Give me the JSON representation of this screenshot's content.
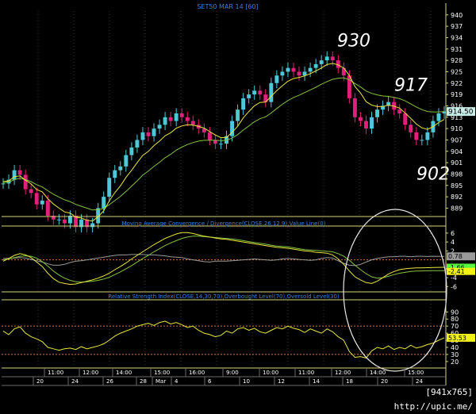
{
  "window": {
    "footer": "[941x765] http://upic.me/"
  },
  "colors": {
    "background": "#000000",
    "frame": "#d4d47a",
    "grid": "#3a3a3a",
    "title": "#3e7fd9",
    "price_up": "#4ec7d6",
    "price_down": "#e0207a",
    "ma_short": "#e8e83a",
    "ma_long": "#86c23d",
    "ref_line": "#d8763a",
    "macd_hist": "#9a9a9a",
    "annotation": "#ffffff",
    "last_price_box": "#c8ece6",
    "macd_box1": "#9a9a9a",
    "macd_box2": "#56ff3c",
    "macd_box3": "#f2f215",
    "rsi_box": "#f2f215"
  },
  "chart_data": [
    {
      "type": "line",
      "title": "SET50 MAR 14   [60]",
      "ylim": [
        887,
        941
      ],
      "yticks": [
        889,
        892,
        895,
        898,
        901,
        904,
        907,
        910,
        913,
        916,
        919,
        922,
        925,
        928,
        931,
        934,
        937,
        940
      ],
      "last_price": "914.50",
      "series": [
        {
          "name": "Close",
          "values": [
            895.5,
            896.5,
            899,
            897.8,
            894,
            893,
            890,
            891,
            887,
            886,
            886,
            885,
            887,
            884,
            886,
            884,
            885,
            889,
            892,
            897,
            899,
            900,
            903,
            905,
            907,
            909,
            908,
            910,
            911,
            913,
            912,
            914,
            913,
            912,
            911,
            910,
            909,
            907,
            906,
            906,
            908,
            912,
            915,
            918,
            919,
            920,
            919,
            917,
            922,
            924,
            925,
            926,
            925,
            924,
            925,
            926,
            927,
            928,
            929,
            928,
            926,
            924,
            918,
            913,
            912,
            910,
            913,
            915,
            916,
            917,
            915,
            914,
            911,
            909,
            907,
            907,
            909,
            912,
            914,
            914.5
          ]
        },
        {
          "name": "MA short",
          "values": [
            896,
            896.2,
            897.3,
            897.5,
            896.4,
            895.4,
            893.9,
            893.3,
            891.5,
            890.1,
            889,
            888,
            887.7,
            886.6,
            886.4,
            885.8,
            885.6,
            886.7,
            888.3,
            890.9,
            893.1,
            894.9,
            897.1,
            899,
            901,
            902.9,
            904,
            905.5,
            906.7,
            908.1,
            908.9,
            910.1,
            910.7,
            911,
            910.9,
            910.6,
            910.1,
            909.2,
            908.3,
            907.6,
            907.7,
            909,
            910.6,
            912.8,
            914.5,
            916,
            916.9,
            917,
            918.5,
            920,
            921.3,
            922.5,
            923.2,
            923.5,
            923.9,
            924.5,
            925.2,
            926,
            926.9,
            927.2,
            926.8,
            926,
            924,
            921.1,
            919.4,
            917.1,
            916.2,
            915.8,
            915.8,
            916.2,
            915.9,
            915.4,
            914.1,
            912.7,
            911.2,
            910.2,
            909.8,
            910.5,
            911.6,
            912.4
          ]
        },
        {
          "name": "MA long",
          "values": [
            895.7,
            895.9,
            896.5,
            896.9,
            896.5,
            896,
            895.2,
            894.6,
            893.6,
            892.7,
            891.9,
            891.2,
            890.7,
            890,
            889.5,
            889,
            888.5,
            888.6,
            888.9,
            889.9,
            891,
            892.1,
            893.4,
            894.8,
            896.2,
            897.7,
            898.8,
            900,
            901.1,
            902.3,
            903.2,
            904.3,
            905.1,
            905.8,
            906.3,
            906.7,
            906.9,
            906.9,
            906.9,
            906.8,
            906.9,
            907.5,
            908.4,
            909.6,
            910.7,
            911.8,
            912.6,
            913.1,
            914.1,
            915.3,
            916.4,
            917.4,
            918.2,
            918.8,
            919.5,
            920.2,
            920.9,
            921.7,
            922.4,
            923,
            923.3,
            923.4,
            922.9,
            921.9,
            921,
            919.9,
            919.3,
            918.9,
            918.6,
            918.5,
            918.2,
            917.9,
            917.3,
            916.5,
            915.7,
            915,
            914.5,
            914.4,
            914.4,
            914.5
          ]
        }
      ],
      "annotations": [
        {
          "text": "930",
          "value": 930
        },
        {
          "text": "917",
          "value": 917
        },
        {
          "text": "902",
          "value": 902
        }
      ]
    },
    {
      "type": "line",
      "title": "Moving Average Convergence / Divergence(CLOSE,26,12,9),Value Line(0)",
      "ylim": [
        -7,
        7.4
      ],
      "yticks": [
        6,
        4,
        2,
        -2,
        -4,
        -6
      ],
      "zero_line": 0,
      "labels": {
        "hist": "0.78",
        "macd": "-1.66",
        "signal": "-2.41"
      },
      "series": [
        {
          "name": "MACD",
          "values": [
            -0.3,
            0.3,
            1,
            1.4,
            1.1,
            0.5,
            -0.5,
            -1.5,
            -3,
            -4.2,
            -5,
            -5.3,
            -5.5,
            -5.4,
            -5.1,
            -4.8,
            -4.5,
            -4.1,
            -3.6,
            -3,
            -2.2,
            -1.5,
            -0.7,
            0.2,
            1,
            1.8,
            2.6,
            3.4,
            4.1,
            4.8,
            5.3,
            5.8,
            6.1,
            6.1,
            5.9,
            5.6,
            5.3,
            5.1,
            4.9,
            4.7,
            4.6,
            4.4,
            4.2,
            4,
            3.8,
            3.6,
            3.4,
            3.2,
            3,
            2.8,
            2.7,
            2.6,
            2.4,
            2.2,
            2,
            1.9,
            1.7,
            1.6,
            1.5,
            1.1,
            0.2,
            -1,
            -2.5,
            -3.8,
            -4.5,
            -5.1,
            -5.3,
            -4.8,
            -4,
            -3.2,
            -2.6,
            -2.2,
            -2,
            -1.9,
            -1.8,
            -1.8,
            -1.75,
            -1.7,
            -1.68,
            -1.66
          ]
        },
        {
          "name": "Signal",
          "values": [
            0,
            0.2,
            0.5,
            0.8,
            0.9,
            0.8,
            0.4,
            -0.4,
            -1.4,
            -2.5,
            -3.4,
            -4.1,
            -4.6,
            -4.9,
            -5,
            -4.9,
            -4.8,
            -4.6,
            -4.3,
            -3.9,
            -3.3,
            -2.7,
            -2,
            -1.3,
            -0.5,
            0.3,
            1,
            1.8,
            2.5,
            3.2,
            3.8,
            4.3,
            4.8,
            5.1,
            5.3,
            5.3,
            5.2,
            5.1,
            5,
            4.9,
            4.8,
            4.7,
            4.5,
            4.3,
            4.1,
            3.9,
            3.7,
            3.5,
            3.3,
            3.1,
            3,
            2.9,
            2.7,
            2.5,
            2.3,
            2.2,
            2.1,
            2,
            1.9,
            1.8,
            1.4,
            0.8,
            -0.1,
            -1.2,
            -2.2,
            -3.1,
            -3.8,
            -4.1,
            -4,
            -3.7,
            -3.3,
            -3,
            -2.8,
            -2.6,
            -2.5,
            -2.48,
            -2.45,
            -2.43,
            -2.42,
            -2.41
          ]
        },
        {
          "name": "Hist",
          "values": [
            0.3,
            0.3,
            0.4,
            0.5,
            0.4,
            0.1,
            -0.2,
            -0.5,
            -0.9,
            -1.2,
            -1.2,
            -1,
            -0.6,
            -0.3,
            -0.2,
            0,
            0.2,
            0.4,
            0.6,
            0.8,
            1,
            1.1,
            1.1,
            1.2,
            1.2,
            1.2,
            1.1,
            1.1,
            1,
            0.9,
            0.7,
            0.6,
            0.5,
            0.2,
            0,
            -0.2,
            -0.4,
            -0.5,
            -0.3,
            -0.3,
            -0.3,
            -0.2,
            -0.1,
            0,
            0.1,
            0.2,
            0.1,
            0,
            -0.1,
            0,
            0.2,
            0.3,
            0.2,
            0.1,
            0,
            -0.1,
            0,
            0.3,
            0.5,
            0.4,
            -0.2,
            -0.8,
            -1.2,
            -1.3,
            -1,
            -0.5,
            0,
            0.3,
            0.5,
            0.7,
            0.7,
            0.8,
            0.8,
            0.7,
            0.8,
            0.8,
            0.75,
            0.8,
            0.78,
            0.78
          ]
        }
      ]
    },
    {
      "type": "line",
      "title": "Relative Strength Index(CLOSE,14,30,70),Overbought Level(70),Oversold Level(30)",
      "ylim": [
        12,
        106
      ],
      "yticks": [
        90,
        80,
        70,
        60,
        50,
        40,
        30,
        20
      ],
      "levels": [
        70,
        30
      ],
      "last_value": "53.53",
      "series": [
        {
          "name": "RSI",
          "values": [
            63,
            58,
            66,
            69,
            60,
            55,
            52,
            48,
            40,
            38,
            36,
            38,
            39,
            37,
            41,
            38,
            40,
            42,
            45,
            50,
            56,
            60,
            63,
            66,
            70,
            72,
            74,
            71,
            75,
            77,
            73,
            75,
            72,
            68,
            70,
            64,
            60,
            58,
            55,
            57,
            63,
            60,
            66,
            68,
            64,
            67,
            62,
            60,
            64,
            68,
            66,
            70,
            67,
            65,
            61,
            66,
            63,
            60,
            66,
            62,
            55,
            50,
            34,
            26,
            27,
            25,
            35,
            40,
            38,
            42,
            37,
            40,
            38,
            43,
            39,
            41,
            44,
            46,
            50,
            53.53
          ]
        }
      ]
    }
  ],
  "x_axis": {
    "time_labels": [
      "11:00",
      "12:00",
      "14:00",
      "15:00",
      "16:00",
      "9:00",
      "10:00",
      "11:00",
      "12:00",
      "14:00",
      "15:00"
    ],
    "date_labels": [
      "20",
      "24",
      "26",
      "28",
      "Mar",
      "4",
      "6",
      "10",
      "12",
      "14",
      "18",
      "20",
      "24"
    ]
  }
}
